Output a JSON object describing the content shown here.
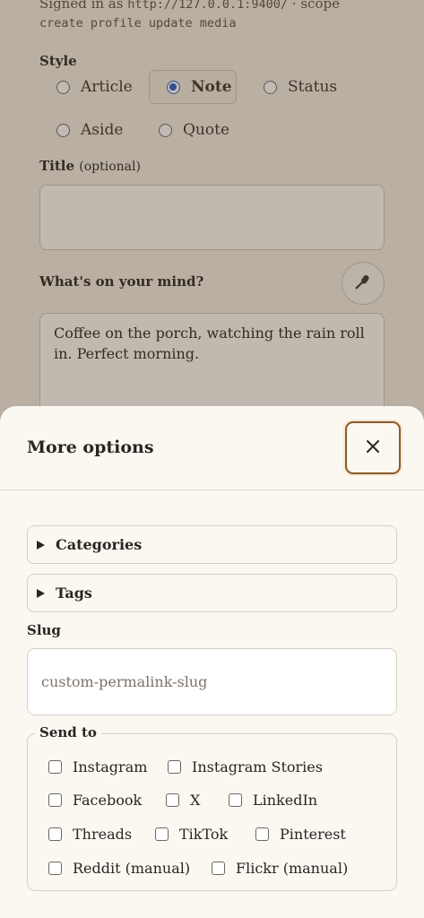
{
  "background": {
    "signed_in_prefix": "Signed in as ",
    "signed_in_url": "http://127.0.0.1:9400/",
    "signed_in_suffix": " · scope",
    "scope_line": "create profile update media",
    "style_label": "Style",
    "style_options": [
      "Article",
      "Note",
      "Status",
      "Aside",
      "Quote"
    ],
    "style_selected": "Note",
    "title_label": "Title",
    "title_optional": "(optional)",
    "title_value": "",
    "body_label": "What's on your mind?",
    "body_value": "Coffee on the porch, watching the rain roll in. Perfect morning.",
    "mic_icon": "microphone-icon"
  },
  "sheet": {
    "title": "More options",
    "close_icon": "close-icon",
    "categories_label": "Categories",
    "tags_label": "Tags",
    "slug_label": "Slug",
    "slug_placeholder": "custom-permalink-slug",
    "slug_value": "",
    "send_to_label": "Send to",
    "send_to_options": [
      "Instagram",
      "Instagram Stories",
      "Facebook",
      "X",
      "LinkedIn",
      "Threads",
      "TikTok",
      "Pinterest",
      "Reddit (manual)",
      "Flickr (manual)"
    ]
  },
  "colors": {
    "accent": "#2d5bd0",
    "close_border": "#8a5a28",
    "sheet_bg": "#fbf8f2"
  }
}
